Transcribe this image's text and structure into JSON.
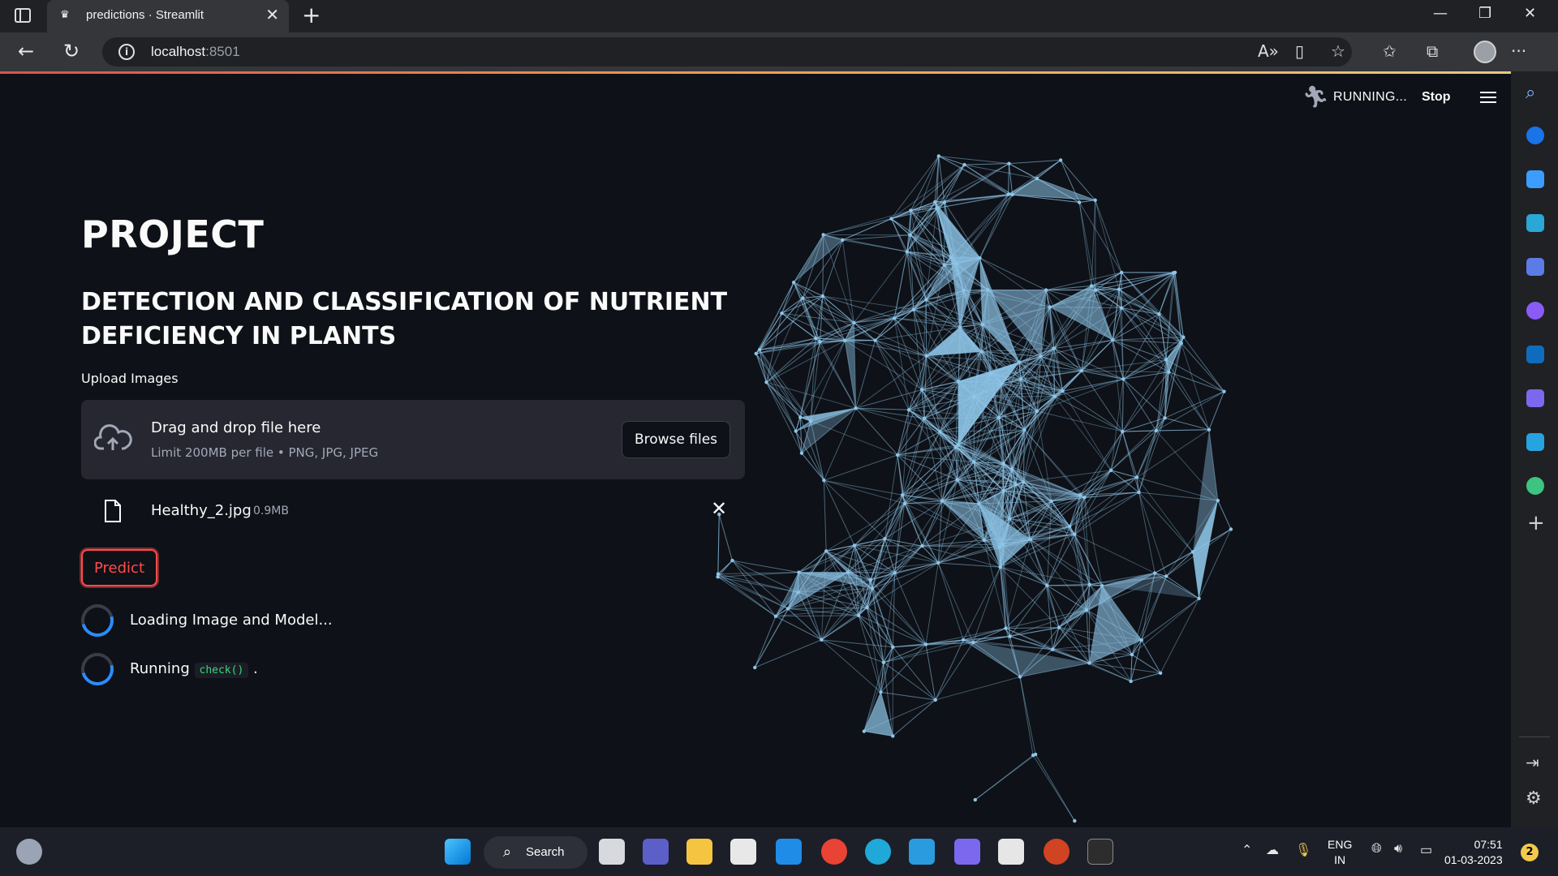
{
  "browser": {
    "tab_title": "predictions · Streamlit",
    "url_host": "localhost",
    "url_port": ":8501"
  },
  "app_header": {
    "status": "RUNNING...",
    "stop_label": "Stop"
  },
  "main": {
    "title": "PROJECT",
    "subtitle": "DETECTION AND CLASSIFICATION OF NUTRIENT DEFICIENCY IN PLANTS",
    "uploader": {
      "label": "Upload Images",
      "drop_text": "Drag and drop file here",
      "limit_text": "Limit 200MB per file • PNG, JPG, JPEG",
      "browse_label": "Browse files",
      "file_name": "Healthy_2.jpg",
      "file_size": "0.9MB"
    },
    "predict_label": "Predict",
    "spinners": [
      {
        "text": "Loading Image and Model..."
      },
      {
        "prefix": "Running",
        "code": "check()",
        "suffix": "."
      }
    ]
  },
  "taskbar": {
    "search_label": "Search",
    "lang_top": "ENG",
    "lang_bottom": "IN",
    "time": "07:51",
    "date": "01-03-2023",
    "notifications": "2"
  },
  "colors": {
    "accent": "#ff4b4b",
    "background": "#0e1117",
    "network": "#8ec5e8"
  }
}
